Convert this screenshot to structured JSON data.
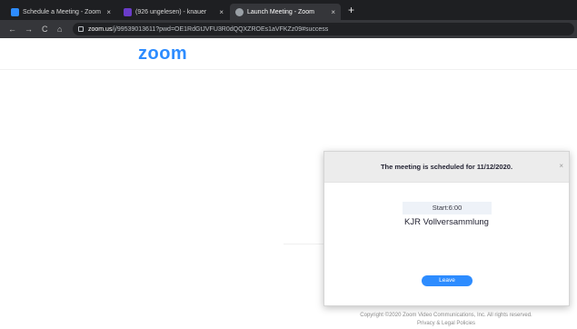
{
  "browser": {
    "tabs": [
      {
        "title": "Schedule a Meeting - Zoom",
        "favicon_color": "#2d8cff"
      },
      {
        "title": "(926 ungelesen) - knauer",
        "favicon_color": "#6a3cc9"
      },
      {
        "title": "Launch Meeting - Zoom",
        "favicon_color": "#9aa0a6"
      }
    ],
    "new_tab": "+",
    "close_glyph": "×",
    "url_host": "zoom.us",
    "url_path": "/j/99539013611?pwd=OE1RdGtJVFU3R0dQQXZROEs1aVFKZz09#success",
    "nav": {
      "back": "←",
      "forward": "→",
      "reload": "C",
      "home": "⌂"
    }
  },
  "page": {
    "logo": "zoom",
    "dialog": {
      "title": "The meeting is scheduled for 11/12/2020.",
      "close_glyph": "×",
      "start": "Start:6:00",
      "meeting_title": "KJR Vollversammlung",
      "leave_button": "Leave"
    },
    "footer": {
      "copyright": "Copyright ©2020 Zoom Video Communications, Inc. All rights reserved.",
      "policies": "Privacy & Legal Policies"
    }
  },
  "colors": {
    "brand": "#2d8cff"
  }
}
